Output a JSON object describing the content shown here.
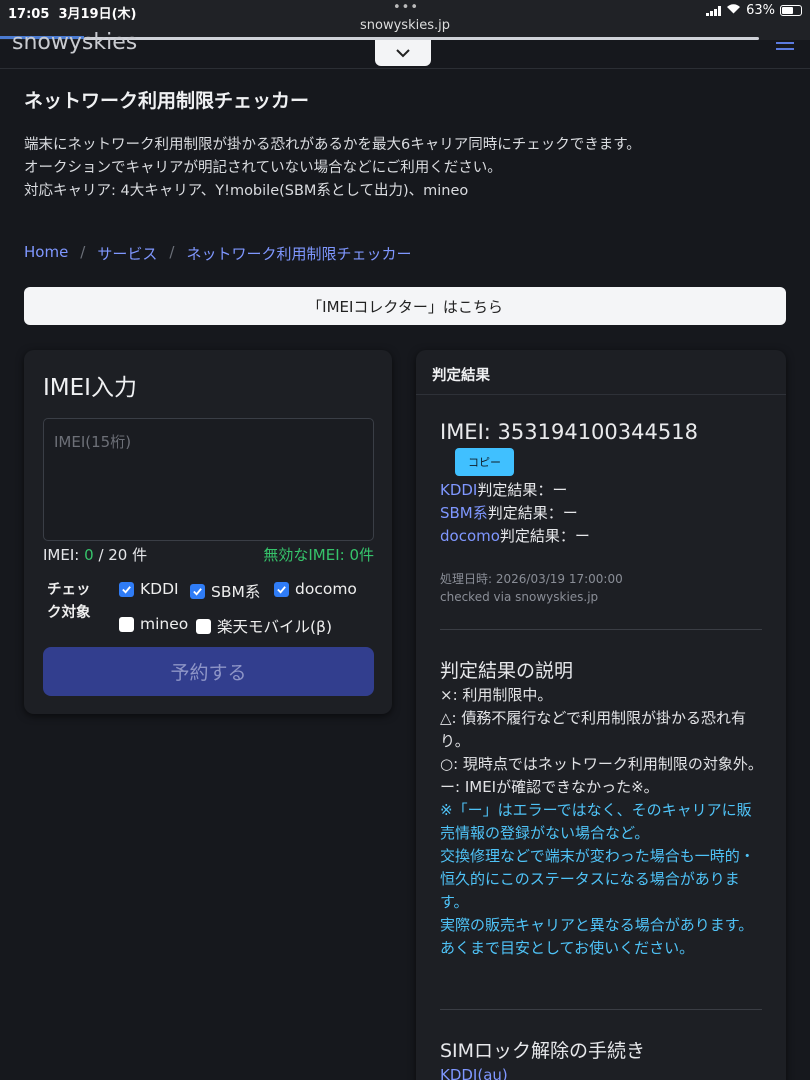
{
  "status_bar": {
    "time": "17:05",
    "date": "3月19日(木)",
    "url": "snowyskies.jp",
    "battery": "63%"
  },
  "nav": {
    "brand": "snowyskies"
  },
  "page": {
    "title": "ネットワーク利用制限チェッカー",
    "description_lines": [
      "端末にネットワーク利用制限が掛かる恐れがあるかを最大6キャリア同時にチェックできます。",
      "オークションでキャリアが明記されていない場合などにご利用ください。",
      "対応キャリア: 4大キャリア、Y!mobile(SBM系として出力)、mineo"
    ]
  },
  "breadcrumb": {
    "items": [
      "Home",
      "サービス",
      "ネットワーク利用制限チェッカー"
    ],
    "separator": "/"
  },
  "imei_collector_button": "「IMEIコレクター」はこちら",
  "input_card": {
    "title": "IMEI入力",
    "placeholder": "IMEI(15桁)",
    "count_prefix": "IMEI:",
    "count_value": "0",
    "count_suffix": "/ 20 件",
    "invalid_label": "無効なIMEI: 0件",
    "check_target_label": "チェック対象",
    "carriers": [
      {
        "label": "KDDI",
        "checked": true
      },
      {
        "label": "SBM系",
        "checked": true
      },
      {
        "label": "docomo",
        "checked": true
      },
      {
        "label": "mineo",
        "checked": false
      },
      {
        "label": "楽天モバイル(β)",
        "checked": false
      }
    ],
    "submit_label": "予約する"
  },
  "result_card": {
    "header": "判定結果",
    "imei": "IMEI: 353194100344518",
    "copy_label": "コピー",
    "results": [
      {
        "carrier": "KDDI",
        "suffix": "判定結果：ー"
      },
      {
        "carrier": "SBM系",
        "suffix": "判定結果：ー"
      },
      {
        "carrier": "docomo",
        "suffix": "判定結果：ー"
      }
    ],
    "processed": "処理日時: 2026/03/19 17:00:00",
    "checked_via": "checked via snowyskies.jp",
    "explanation_title": "判定結果の説明",
    "explanation": [
      "×: 利用制限中。",
      "△: 債務不履行などで利用制限が掛かる恐れ有り。",
      "○: 現時点ではネットワーク利用制限の対象外。",
      "ー: IMEIが確認できなかった※。"
    ],
    "notes": [
      "※「ー」はエラーではなく、そのキャリアに販売情報の登録がない場合など。",
      "交換修理などで端末が変わった場合も一時的・恒久的にこのステータスになる場合があります。",
      "実際の販売キャリアと異なる場合があります。あくまで目安としてお使いください。"
    ],
    "simlock_title": "SIMロック解除の手続き",
    "simlock_link": "KDDI(au)"
  },
  "colors": {
    "background": "#16181d",
    "link": "#7f97ff",
    "note": "#4fc3f7",
    "valid_green": "#36c46b",
    "submit": "#323e8e",
    "checkbox": "#2f7cf6"
  }
}
